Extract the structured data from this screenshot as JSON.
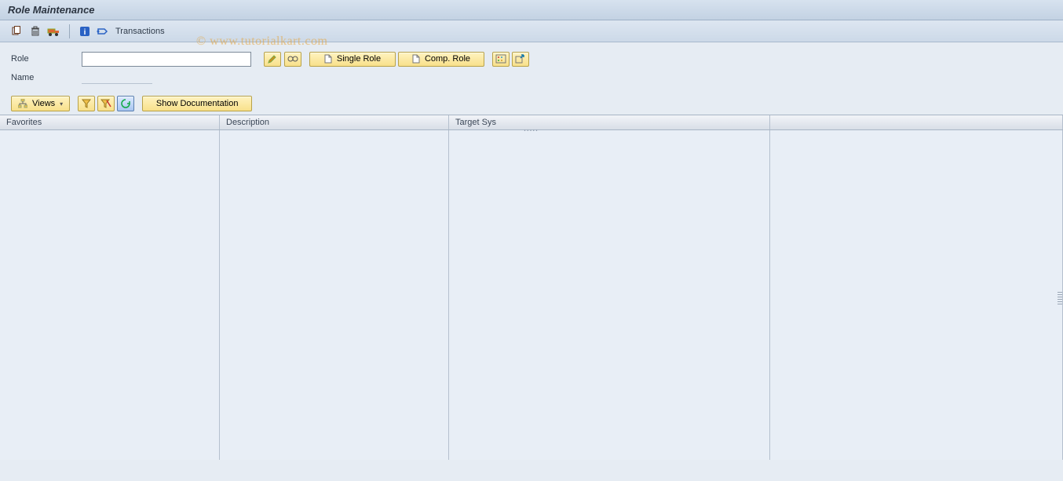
{
  "title": "Role Maintenance",
  "watermark": "© www.tutorialkart.com",
  "apptoolbar": {
    "copy_icon": "copy-icon",
    "delete_icon": "trash-icon",
    "transport_icon": "transport-icon",
    "info_icon": "info-icon",
    "transactions_icon": "transactions-icon",
    "transactions_label": "Transactions"
  },
  "form": {
    "role_label": "Role",
    "role_value": "",
    "name_label": "Name",
    "name_value": "",
    "edit_icon": "pencil-icon",
    "display_icon": "glasses-icon",
    "single_role_doc_icon": "document-icon",
    "single_role_label": "Single Role",
    "comp_role_doc_icon": "document-icon",
    "comp_role_label": "Comp. Role",
    "variant_icon": "variant-icon",
    "export_icon": "export-icon"
  },
  "doc_toolbar": {
    "views_icon": "hierarchy-icon",
    "views_label": "Views",
    "filter_icon": "filter-icon",
    "filter_reset_icon": "filter-reset-icon",
    "refresh_icon": "refresh-icon",
    "show_doc_label": "Show Documentation"
  },
  "grid": {
    "columns": {
      "favorites": "Favorites",
      "description": "Description",
      "target_sys": "Target Sys"
    },
    "rows": []
  }
}
